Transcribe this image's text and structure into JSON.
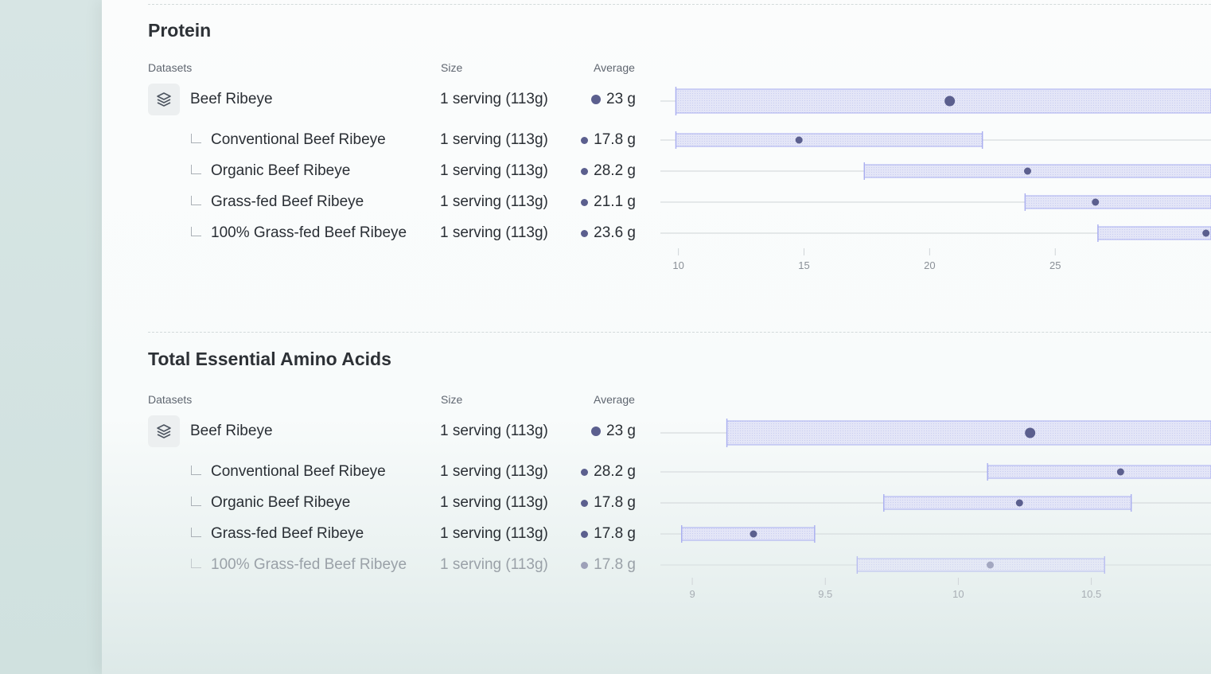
{
  "colors": {
    "accent_dot": "#5b5f8e",
    "range_fill": "#e3e5f7",
    "range_stroke": "#a9aef0",
    "track": "#d7dcde"
  },
  "icons": {
    "dataset_group": "layers-icon",
    "tree_branch": "tree-branch-icon"
  },
  "sections": [
    {
      "title": "Protein",
      "headers": {
        "datasets": "Datasets",
        "size": "Size",
        "average": "Average"
      },
      "rows": [
        {
          "label": "Beef Ribeye",
          "size": "1 serving (113g)",
          "average": "23 g",
          "parent": true
        },
        {
          "label": "Conventional Beef Ribeye",
          "size": "1 serving (113g)",
          "average": "17.8 g"
        },
        {
          "label": "Organic Beef Ribeye",
          "size": "1 serving (113g)",
          "average": "28.2 g"
        },
        {
          "label": "Grass-fed Beef Ribeye",
          "size": "1 serving (113g)",
          "average": "21.1 g"
        },
        {
          "label": "100% Grass-fed Beef Ribeye",
          "size": "1 serving (113g)",
          "average": "23.6 g"
        }
      ]
    },
    {
      "title": "Total Essential Amino Acids",
      "headers": {
        "datasets": "Datasets",
        "size": "Size",
        "average": "Average"
      },
      "rows": [
        {
          "label": "Beef Ribeye",
          "size": "1 serving (113g)",
          "average": "23 g",
          "parent": true
        },
        {
          "label": "Conventional Beef Ribeye",
          "size": "1 serving (113g)",
          "average": "28.2 g"
        },
        {
          "label": "Organic Beef Ribeye",
          "size": "1 serving (113g)",
          "average": "17.8 g"
        },
        {
          "label": "Grass-fed Beef Ribeye",
          "size": "1 serving (113g)",
          "average": "17.8 g"
        },
        {
          "label": "100% Grass-fed Beef Ribeye",
          "size": "1 serving (113g)",
          "average": "17.8 g"
        }
      ]
    }
  ],
  "chart_data": [
    {
      "type": "range-dot",
      "title": "Protein",
      "x_ticks": [
        10,
        15,
        20,
        25
      ],
      "xlim": [
        9.6,
        31.2
      ],
      "series": [
        {
          "name": "Beef Ribeye",
          "range": [
            9.9,
            31.2
          ],
          "mean": 20.8
        },
        {
          "name": "Conventional Beef Ribeye",
          "range": [
            9.9,
            22.1
          ],
          "mean": 14.8
        },
        {
          "name": "Organic Beef Ribeye",
          "range": [
            17.4,
            31.2
          ],
          "mean": 23.9
        },
        {
          "name": "Grass-fed Beef Ribeye",
          "range": [
            23.8,
            31.2
          ],
          "mean": 26.6
        },
        {
          "name": "100% Grass-fed Beef Ribeye",
          "range": [
            26.7,
            31.2
          ],
          "mean": 31.0
        }
      ]
    },
    {
      "type": "range-dot",
      "title": "Total Essential Amino Acids",
      "x_ticks": [
        9,
        9.5,
        10,
        10.5
      ],
      "x_tick_labels": [
        "9",
        "9.5",
        "10",
        "10.5"
      ],
      "xlim": [
        8.91,
        10.95
      ],
      "series": [
        {
          "name": "Beef Ribeye",
          "range": [
            9.13,
            10.95
          ],
          "mean": 10.27
        },
        {
          "name": "Conventional Beef Ribeye",
          "range": [
            10.11,
            10.95
          ],
          "mean": 10.61
        },
        {
          "name": "Organic Beef Ribeye",
          "range": [
            9.72,
            10.65
          ],
          "mean": 10.23
        },
        {
          "name": "Grass-fed Beef Ribeye",
          "range": [
            8.96,
            9.46
          ],
          "mean": 9.23
        },
        {
          "name": "100% Grass-fed Beef Ribeye",
          "range": [
            9.62,
            10.55
          ],
          "mean": 10.12
        }
      ]
    }
  ]
}
